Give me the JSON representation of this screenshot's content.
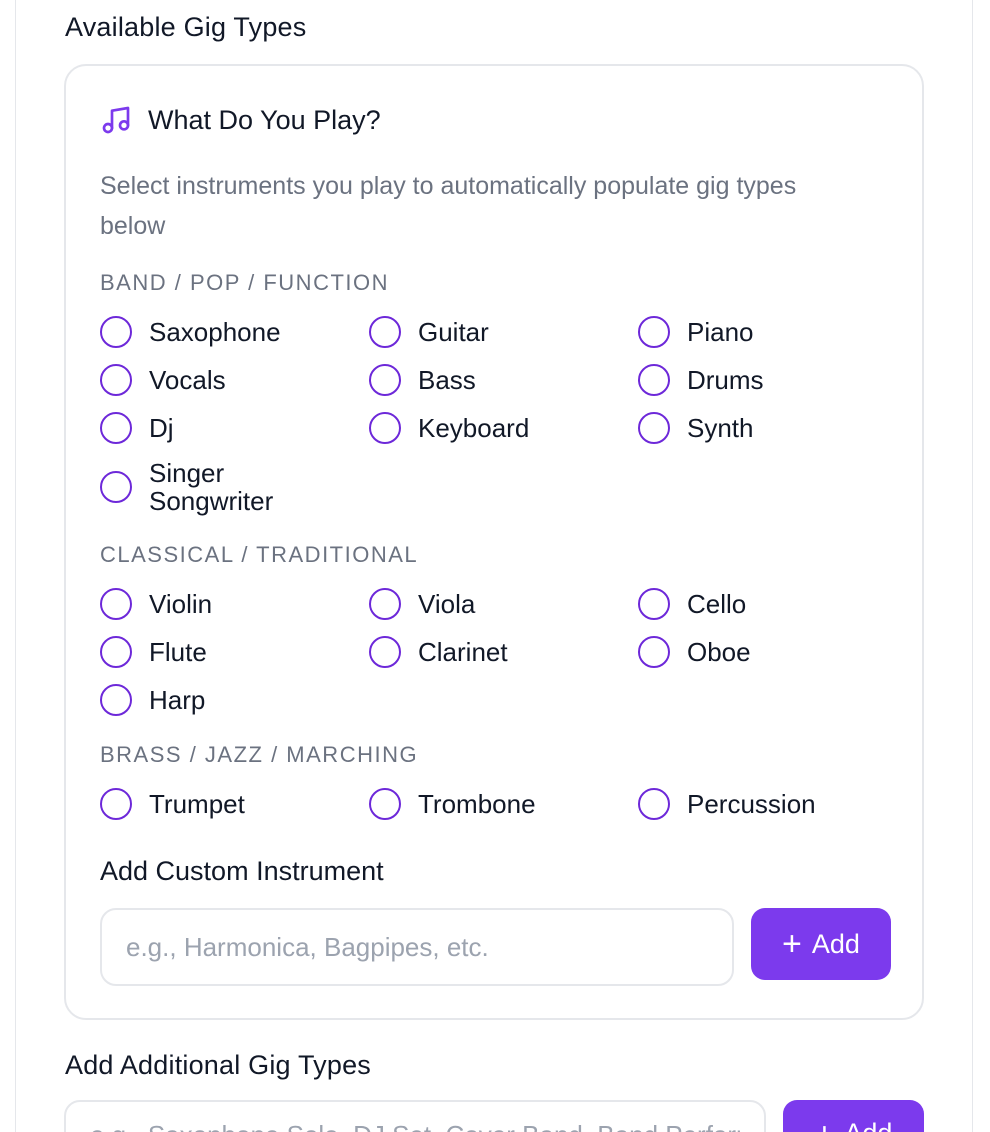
{
  "header": {
    "available_title": "Available Gig Types"
  },
  "card": {
    "icon": "music-note-icon",
    "title": "What Do You Play?",
    "description": "Select instruments you play to automatically populate gig types below",
    "categories": [
      {
        "label": "BAND / POP / FUNCTION",
        "items": [
          "Saxophone",
          "Guitar",
          "Piano",
          "Vocals",
          "Bass",
          "Drums",
          "Dj",
          "Keyboard",
          "Synth",
          "Singer\nSongwriter"
        ]
      },
      {
        "label": "CLASSICAL / TRADITIONAL",
        "items": [
          "Violin",
          "Viola",
          "Cello",
          "Flute",
          "Clarinet",
          "Oboe",
          "Harp"
        ]
      },
      {
        "label": "BRASS / JAZZ / MARCHING",
        "items": [
          "Trumpet",
          "Trombone",
          "Percussion"
        ]
      }
    ],
    "custom": {
      "label": "Add Custom Instrument",
      "placeholder": "e.g., Harmonica, Bagpipes, etc.",
      "button_label": "Add"
    }
  },
  "additional": {
    "title": "Add Additional Gig Types",
    "placeholder": "e.g., Saxophone Solo, DJ Set, Cover Band, Band Performance",
    "button_label": "Add"
  },
  "colors": {
    "accent": "#7c3aed",
    "radio_border": "#6d28d9",
    "muted_text": "#6b7280",
    "border": "#e5e7eb"
  }
}
